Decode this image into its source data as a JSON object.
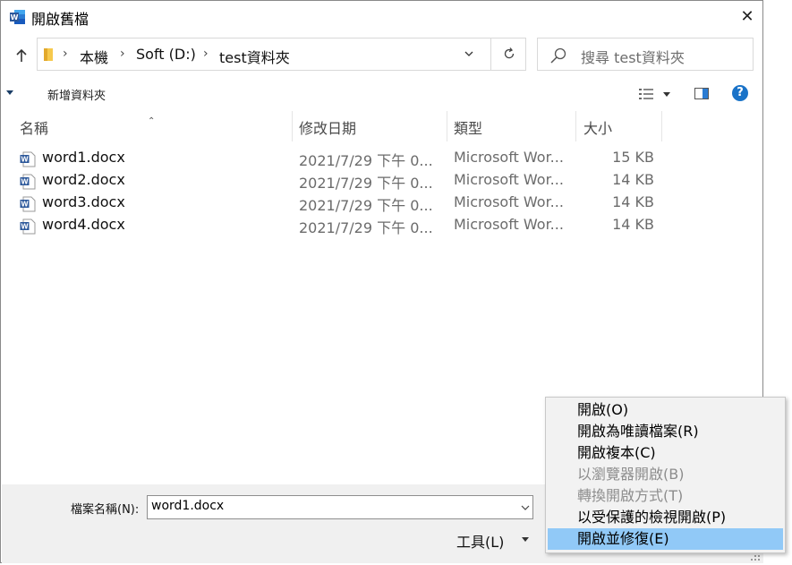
{
  "window": {
    "title": "開啟舊檔",
    "close_label": "✕"
  },
  "address": {
    "crumbs": [
      "本機",
      "Soft (D:)",
      "test資料夾"
    ]
  },
  "search": {
    "placeholder": "搜尋 test資料夾"
  },
  "toolbar": {
    "new_folder_label": "新增資料夾",
    "help_label": "?"
  },
  "list": {
    "columns": [
      "名稱",
      "修改日期",
      "類型",
      "大小"
    ],
    "files": [
      {
        "name": "word1.docx",
        "date": "2021/7/29 下午 0...",
        "type": "Microsoft Wor...",
        "size": "15 KB"
      },
      {
        "name": "word2.docx",
        "date": "2021/7/29 下午 0...",
        "type": "Microsoft Wor...",
        "size": "14 KB"
      },
      {
        "name": "word3.docx",
        "date": "2021/7/29 下午 0...",
        "type": "Microsoft Wor...",
        "size": "14 KB"
      },
      {
        "name": "word4.docx",
        "date": "2021/7/29 下午 0...",
        "type": "Microsoft Wor...",
        "size": "14 KB"
      }
    ]
  },
  "bottom": {
    "filename_label": "檔案名稱(N):",
    "filename_value": "word1.docx",
    "tools_label": "工具(L)"
  },
  "open_menu": {
    "items": [
      {
        "label": "開啟(O)",
        "enabled": true
      },
      {
        "label": "開啟為唯讀檔案(R)",
        "enabled": true
      },
      {
        "label": "開啟複本(C)",
        "enabled": true
      },
      {
        "label": "以瀏覽器開啟(B)",
        "enabled": false
      },
      {
        "label": "轉換開啟方式(T)",
        "enabled": false
      },
      {
        "label": "以受保護的檢視開啟(P)",
        "enabled": true
      },
      {
        "label": "開啟並修復(E)",
        "enabled": true,
        "selected": true
      }
    ]
  },
  "colors": {
    "accent": "#1a73c8",
    "menu_highlight": "#91c9f7",
    "word_blue": "#2b579a"
  }
}
